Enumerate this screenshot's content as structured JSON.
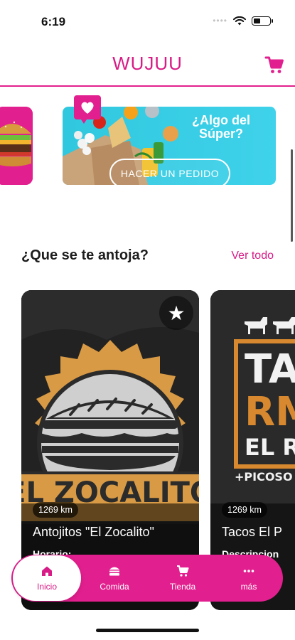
{
  "status_bar": {
    "time": "6:19",
    "icons": [
      "cellular-dots-icon",
      "wifi-icon",
      "battery-icon"
    ]
  },
  "header": {
    "title": "WUJUU",
    "cart_icon": "cart-icon",
    "accent_color": "#e21f8e"
  },
  "banner": {
    "super_title": "¿Algo del Súper?",
    "order_button": "HACER UN PEDIDO",
    "badge_icon": "heart-icon"
  },
  "section": {
    "title": "¿Que se te antoja?",
    "see_all": "Ver todo"
  },
  "restaurants": [
    {
      "logo_text": "EL ZOCALITO",
      "distance": "1269 km",
      "name": "Antojitos \"El Zocalito\"",
      "subtitle": "Horario:",
      "favorite_icon": "star-icon"
    },
    {
      "logo_text": "TACOS RM EL R...",
      "logo_tagline": "+PICOSO",
      "distance": "1269 km",
      "name": "Tacos El P",
      "subtitle": "Descripcion"
    }
  ],
  "bottom_nav": {
    "items": [
      {
        "label": "Inicio",
        "icon": "home-icon"
      },
      {
        "label": "Comida",
        "icon": "burger-icon"
      },
      {
        "label": "Tienda",
        "icon": "cart-icon"
      },
      {
        "label": "más",
        "icon": "more-dots-icon"
      }
    ]
  }
}
